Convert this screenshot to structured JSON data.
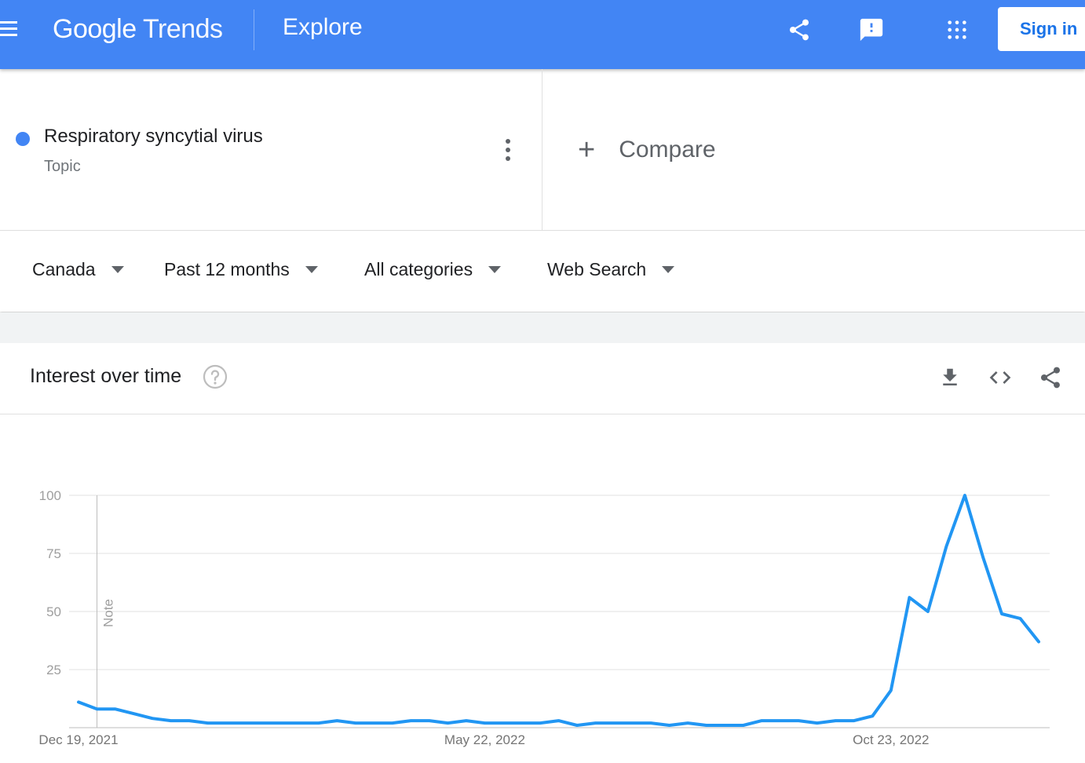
{
  "header": {
    "logo_google": "Google",
    "logo_trends": "Trends",
    "title": "Explore",
    "sign_in": "Sign in"
  },
  "term": {
    "name": "Respiratory syncytial virus",
    "type": "Topic",
    "color": "#4285f4"
  },
  "compare": {
    "label": "Compare"
  },
  "filters": {
    "region": "Canada",
    "period": "Past 12 months",
    "category": "All categories",
    "search_type": "Web Search"
  },
  "card": {
    "title": "Interest over time"
  },
  "chart_data": {
    "type": "line",
    "ylim": [
      0,
      100
    ],
    "yticks": [
      25,
      50,
      75,
      100
    ],
    "xtick_labels": [
      {
        "label": "Dec 19, 2021",
        "index": 0
      },
      {
        "label": "May 22, 2022",
        "index": 22
      },
      {
        "label": "Oct 23, 2022",
        "index": 44
      }
    ],
    "note_label": "Note",
    "note_index": 1,
    "line_color": "#2196f3",
    "series": [
      {
        "values": [
          11,
          8,
          8,
          6,
          4,
          3,
          3,
          2,
          2,
          2,
          2,
          2,
          2,
          2,
          3,
          2,
          2,
          2,
          3,
          3,
          2,
          3,
          2,
          2,
          2,
          2,
          3,
          1,
          2,
          2,
          2,
          2,
          1,
          2,
          1,
          1,
          1,
          3,
          3,
          3,
          2,
          3,
          3,
          5,
          16,
          56,
          50,
          78,
          100,
          73,
          49,
          47,
          37
        ]
      }
    ]
  }
}
